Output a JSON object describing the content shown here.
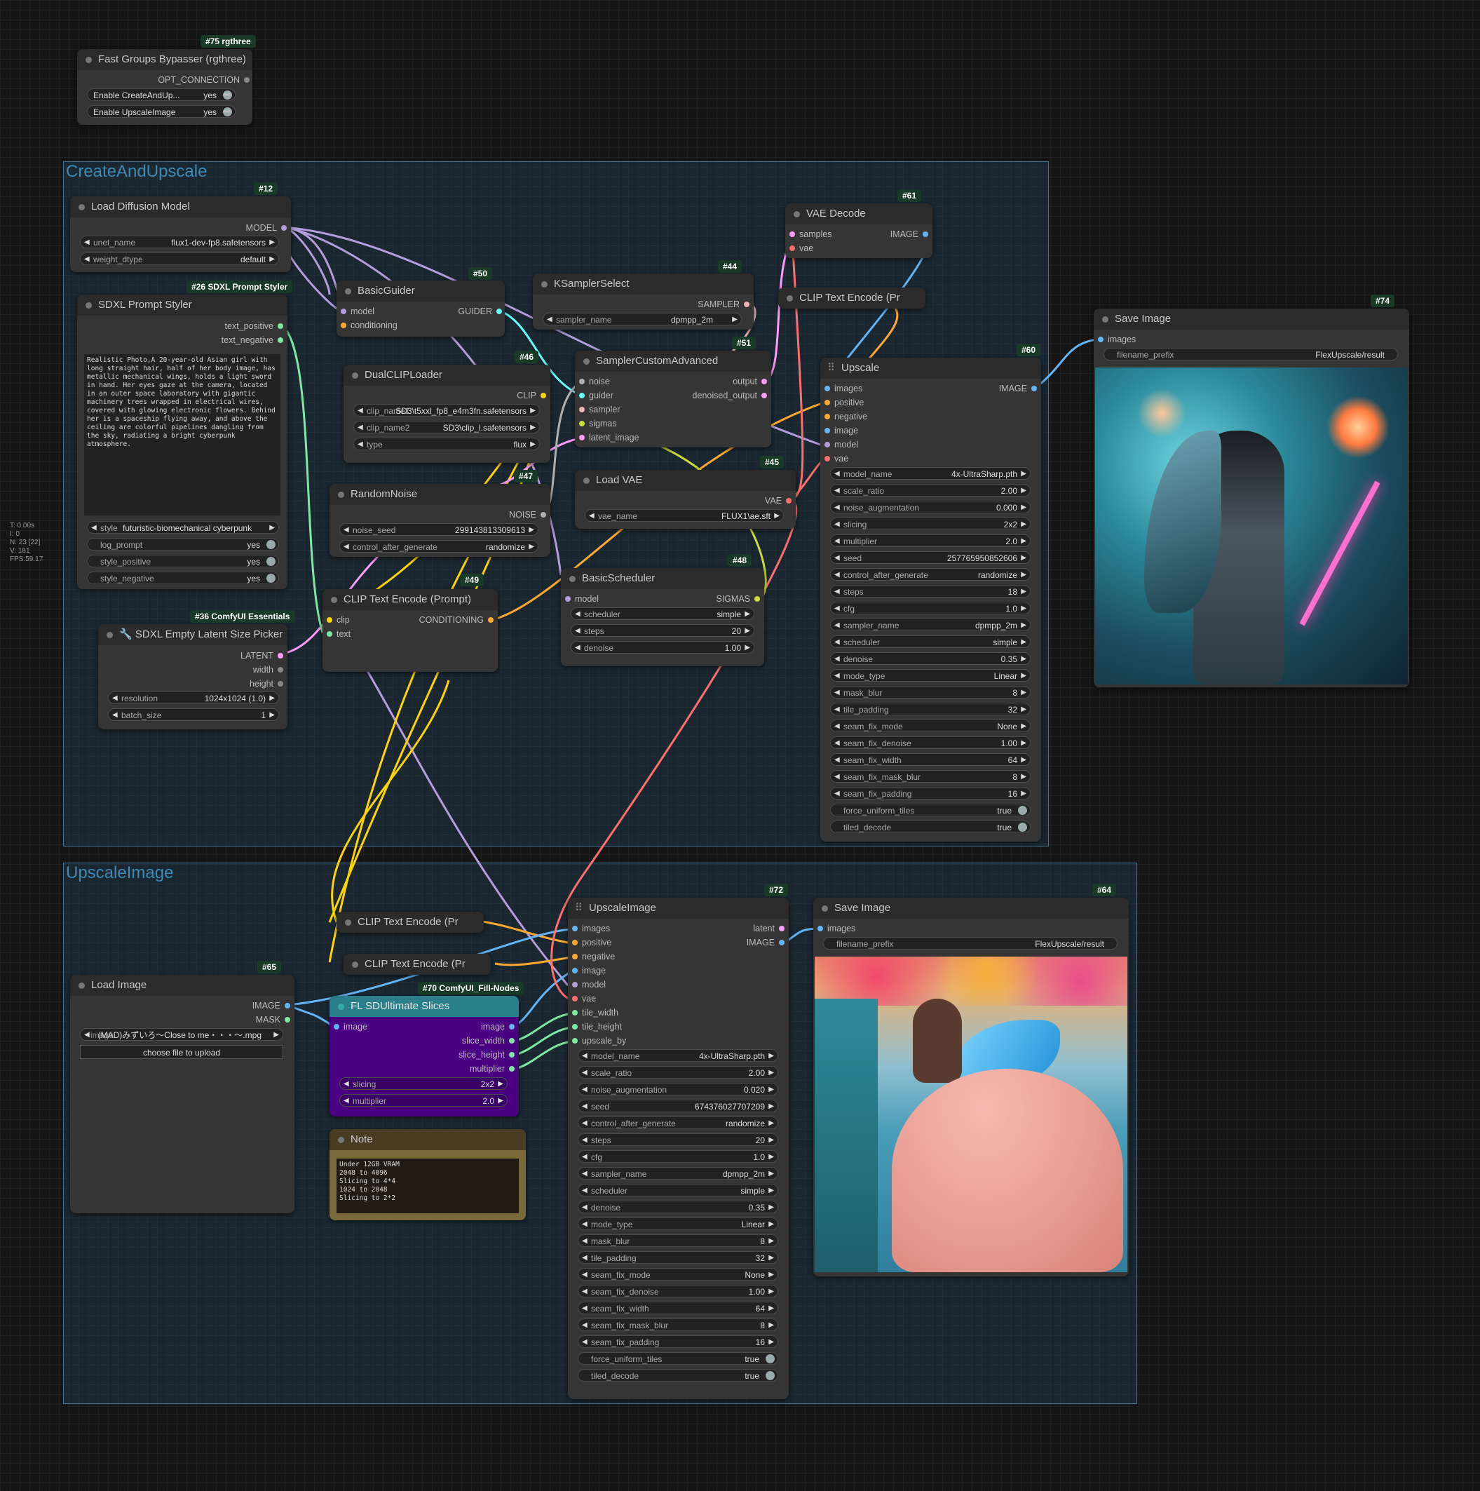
{
  "stats": {
    "time": "T: 0.00s",
    "i": "I: 0",
    "n": "N: 23 [22]",
    "v": "V: 181",
    "fps": "FPS:59.17"
  },
  "groups": {
    "create": "CreateAndUpscale",
    "upscale": "UpscaleImage"
  },
  "colors": {
    "model": "#b39ddb",
    "clip": "#ffd500",
    "conditioning": "#ffa931",
    "vae": "#ff6e6e",
    "latent": "#ff9cf9",
    "image": "#64b5f6",
    "int": "#7ee8a3",
    "sigmas": "#cddc39",
    "sampler": "#ecb4b4",
    "noise": "#b0b0b0",
    "guider": "#66ffff",
    "string": "#7ee8a3"
  },
  "n75": {
    "badge": "#75 rgthree",
    "title": "Fast Groups Bypasser (rgthree)",
    "out": "OPT_CONNECTION",
    "t1": "Enable CreateAndUp...",
    "t1v": "yes",
    "t2": "Enable UpscaleImage",
    "t2v": "yes"
  },
  "n12": {
    "badge": "#12",
    "title": "Load Diffusion Model",
    "out": "MODEL",
    "w1l": "unet_name",
    "w1v": "flux1-dev-fp8.safetensors",
    "w2l": "weight_dtype",
    "w2v": "default"
  },
  "n26": {
    "badge": "#26 SDXL Prompt Styler",
    "title": "SDXL Prompt Styler",
    "o1": "text_positive",
    "o2": "text_negative",
    "text": "Realistic Photo,A 20-year-old Asian girl with long straight hair, half of her body image, has metallic mechanical wings, holds a light sword in hand. Her eyes gaze at the camera, located in an outer space laboratory with gigantic machinery trees wrapped in electrical wires, covered with glowing electronic flowers. Behind her is a spaceship flying away, and above the ceiling are colorful pipelines dangling from the sky, radiating a bright cyberpunk atmosphere.",
    "sl": "style",
    "sv": "futuristic-biomechanical cyberpunk",
    "l1": "log_prompt",
    "l1v": "yes",
    "l2": "style_positive",
    "l2v": "yes",
    "l3": "style_negative",
    "l3v": "yes"
  },
  "n36": {
    "badge": "#36 ComfyUI Essentials",
    "title": "SDXL Empty Latent Size Picker",
    "o1": "LATENT",
    "o2": "width",
    "o3": "height",
    "w1l": "resolution",
    "w1v": "1024x1024 (1.0)",
    "w2l": "batch_size",
    "w2v": "1"
  },
  "n50": {
    "badge": "#50",
    "title": "BasicGuider",
    "i1": "model",
    "i2": "conditioning",
    "out": "GUIDER"
  },
  "n44": {
    "badge": "#44",
    "title": "KSamplerSelect",
    "out": "SAMPLER",
    "wl": "sampler_name",
    "wv": "dpmpp_2m"
  },
  "n46": {
    "badge": "#46",
    "title": "DualCLIPLoader",
    "out": "CLIP",
    "w1l": "clip_name1",
    "w1v": "SD3\\t5xxl_fp8_e4m3fn.safetensors",
    "w2l": "clip_name2",
    "w2v": "SD3\\clip_l.safetensors",
    "w3l": "type",
    "w3v": "flux"
  },
  "n51": {
    "badge": "#51",
    "title": "SamplerCustomAdvanced",
    "i1": "noise",
    "i2": "guider",
    "i3": "sampler",
    "i4": "sigmas",
    "i5": "latent_image",
    "o1": "output",
    "o2": "denoised_output"
  },
  "n61": {
    "badge": "#61",
    "title": "VAE Decode",
    "i1": "samples",
    "i2": "vae",
    "out": "IMAGE"
  },
  "clip1": {
    "title": "CLIP Text Encode (Pr"
  },
  "n47": {
    "badge": "#47",
    "title": "RandomNoise",
    "out": "NOISE",
    "w1l": "noise_seed",
    "w1v": "299143813309613",
    "w2l": "control_after_generate",
    "w2v": "randomize"
  },
  "n45": {
    "badge": "#45",
    "title": "Load VAE",
    "out": "VAE",
    "wl": "vae_name",
    "wv": "FLUX1\\ae.sft"
  },
  "n49": {
    "badge": "#49",
    "title": "CLIP Text Encode (Prompt)",
    "i1": "clip",
    "i2": "text",
    "out": "CONDITIONING"
  },
  "n48": {
    "badge": "#48",
    "title": "BasicScheduler",
    "in": "model",
    "out": "SIGMAS",
    "w1l": "scheduler",
    "w1v": "simple",
    "w2l": "steps",
    "w2v": "20",
    "w3l": "denoise",
    "w3v": "1.00"
  },
  "n60": {
    "badge": "#60",
    "title": "Upscale",
    "inputs": [
      "images",
      "positive",
      "negative",
      "image",
      "model",
      "vae"
    ],
    "out": "IMAGE",
    "widgets": [
      [
        "model_name",
        "4x-UltraSharp.pth"
      ],
      [
        "scale_ratio",
        "2.00"
      ],
      [
        "noise_augmentation",
        "0.000"
      ],
      [
        "slicing",
        "2x2"
      ],
      [
        "multiplier",
        "2.0"
      ],
      [
        "seed",
        "257765950852606"
      ],
      [
        "control_after_generate",
        "randomize"
      ],
      [
        "steps",
        "18"
      ],
      [
        "cfg",
        "1.0"
      ],
      [
        "sampler_name",
        "dpmpp_2m"
      ],
      [
        "scheduler",
        "simple"
      ],
      [
        "denoise",
        "0.35"
      ],
      [
        "mode_type",
        "Linear"
      ],
      [
        "mask_blur",
        "8"
      ],
      [
        "tile_padding",
        "32"
      ],
      [
        "seam_fix_mode",
        "None"
      ],
      [
        "seam_fix_denoise",
        "1.00"
      ],
      [
        "seam_fix_width",
        "64"
      ],
      [
        "seam_fix_mask_blur",
        "8"
      ],
      [
        "seam_fix_padding",
        "16"
      ]
    ],
    "toggles": [
      [
        "force_uniform_tiles",
        "true"
      ],
      [
        "tiled_decode",
        "true"
      ]
    ]
  },
  "n74": {
    "badge": "#74",
    "title": "Save Image",
    "in": "images",
    "wl": "filename_prefix",
    "wv": "FlexUpscale/result"
  },
  "clip2": {
    "title": "CLIP Text Encode (Pr"
  },
  "clip3": {
    "title": "CLIP Text Encode (Pr"
  },
  "n65": {
    "badge": "#65",
    "title": "Load Image",
    "o1": "IMAGE",
    "o2": "MASK",
    "wl": "image",
    "wv": "(MAD)みずいろ〜Close to me・・・〜.mpg",
    "btn": "choose file to upload"
  },
  "n70": {
    "badge": "#70 ComfyUI_Fill-Nodes",
    "title": "FL SDUltimate Slices",
    "in": "image",
    "o1": "image",
    "o2": "slice_width",
    "o3": "slice_height",
    "o4": "multiplier",
    "w1l": "slicing",
    "w1v": "2x2",
    "w2l": "multiplier",
    "w2v": "2.0"
  },
  "note": {
    "title": "Note",
    "text": "Under 12GB VRAM\n2048 to 4096\nSlicing to 4*4\n1024 to 2048\nSlicing to 2*2"
  },
  "n72": {
    "badge": "#72",
    "title": "UpscaleImage",
    "inputs": [
      "images",
      "positive",
      "negative",
      "image",
      "model",
      "vae",
      "tile_width",
      "tile_height",
      "upscale_by"
    ],
    "o1": "latent",
    "o2": "IMAGE",
    "widgets": [
      [
        "model_name",
        "4x-UltraSharp.pth"
      ],
      [
        "scale_ratio",
        "2.00"
      ],
      [
        "noise_augmentation",
        "0.020"
      ],
      [
        "seed",
        "674376027707209"
      ],
      [
        "control_after_generate",
        "randomize"
      ],
      [
        "steps",
        "20"
      ],
      [
        "cfg",
        "1.0"
      ],
      [
        "sampler_name",
        "dpmpp_2m"
      ],
      [
        "scheduler",
        "simple"
      ],
      [
        "denoise",
        "0.35"
      ],
      [
        "mode_type",
        "Linear"
      ],
      [
        "mask_blur",
        "8"
      ],
      [
        "tile_padding",
        "32"
      ],
      [
        "seam_fix_mode",
        "None"
      ],
      [
        "seam_fix_denoise",
        "1.00"
      ],
      [
        "seam_fix_width",
        "64"
      ],
      [
        "seam_fix_mask_blur",
        "8"
      ],
      [
        "seam_fix_padding",
        "16"
      ]
    ],
    "toggles": [
      [
        "force_uniform_tiles",
        "true"
      ],
      [
        "tiled_decode",
        "true"
      ]
    ]
  },
  "n64": {
    "badge": "#64",
    "title": "Save Image",
    "in": "images",
    "wl": "filename_prefix",
    "wv": "FlexUpscale/result"
  }
}
